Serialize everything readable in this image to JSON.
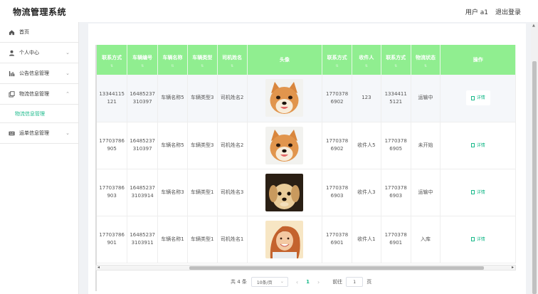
{
  "app": {
    "title": "物流管理系统",
    "user_label": "用户 a1",
    "logout_label": "退出登录"
  },
  "sidebar": {
    "items": [
      {
        "label": "首页",
        "icon": "home-icon",
        "has_chevron": false
      },
      {
        "label": "个人中心",
        "icon": "user-icon",
        "has_chevron": true,
        "chevron": "⌄"
      },
      {
        "label": "公告信息管理",
        "icon": "bar-chart-icon",
        "has_chevron": true,
        "chevron": "⌄"
      },
      {
        "label": "物流信息管理",
        "icon": "copy-icon",
        "has_chevron": true,
        "chevron": "⌃",
        "expanded": true
      },
      {
        "label": "运单信息管理",
        "icon": "tickets-icon",
        "has_chevron": true,
        "chevron": "⌄"
      }
    ],
    "sub_item": "物流信息管理",
    "active_color": "#19b98a"
  },
  "table": {
    "header_color": "#90ee90",
    "columns": [
      "联系方式",
      "车辆编号",
      "车辆名称",
      "车辆类型",
      "司机姓名",
      "头像",
      "联系方式",
      "收件人",
      "联系方式",
      "物流状态",
      "操作"
    ],
    "sort_glyph": "⇅",
    "rows": [
      {
        "phone": "13344115121",
        "vehicle_no": "16485237310397",
        "vehicle_name": "车辆名称5",
        "vehicle_type": "车辆类型3",
        "driver": "司机姓名2",
        "avatar": "shiba-dog",
        "contact": "17703786902",
        "recipient": "123",
        "recipient_phone": "13344115121",
        "status": "运输中",
        "action": "详情"
      },
      {
        "phone": "17703786905",
        "vehicle_no": "16485237310397",
        "vehicle_name": "车辆名称5",
        "vehicle_type": "车辆类型3",
        "driver": "司机姓名2",
        "avatar": "shiba-dog",
        "contact": "17703786902",
        "recipient": "收件人5",
        "recipient_phone": "17703786905",
        "status": "未开始",
        "action": "详情"
      },
      {
        "phone": "17703786903",
        "vehicle_no": "164852373103914",
        "vehicle_name": "车辆名称3",
        "vehicle_type": "车辆类型1",
        "driver": "司机姓名3",
        "avatar": "puppy",
        "contact": "17703786903",
        "recipient": "收件人3",
        "recipient_phone": "17703786903",
        "status": "运输中",
        "action": "详情"
      },
      {
        "phone": "17703786901",
        "vehicle_no": "164852373103911",
        "vehicle_name": "车辆名称1",
        "vehicle_type": "车辆类型1",
        "driver": "司机姓名1",
        "avatar": "smiling-woman",
        "contact": "17703786901",
        "recipient": "收件人1",
        "recipient_phone": "17703786901",
        "status": "入库",
        "action": "详情"
      }
    ]
  },
  "pagination": {
    "total": "共 4 条",
    "page_size": "10条/页",
    "prev": "‹",
    "current": "1",
    "next": "›",
    "goto_label": "前往",
    "goto_value": "1",
    "page_unit": "页"
  },
  "scroll": {
    "left_arrow": "◂",
    "right_arrow": "▸",
    "up_arrow": "▲"
  }
}
